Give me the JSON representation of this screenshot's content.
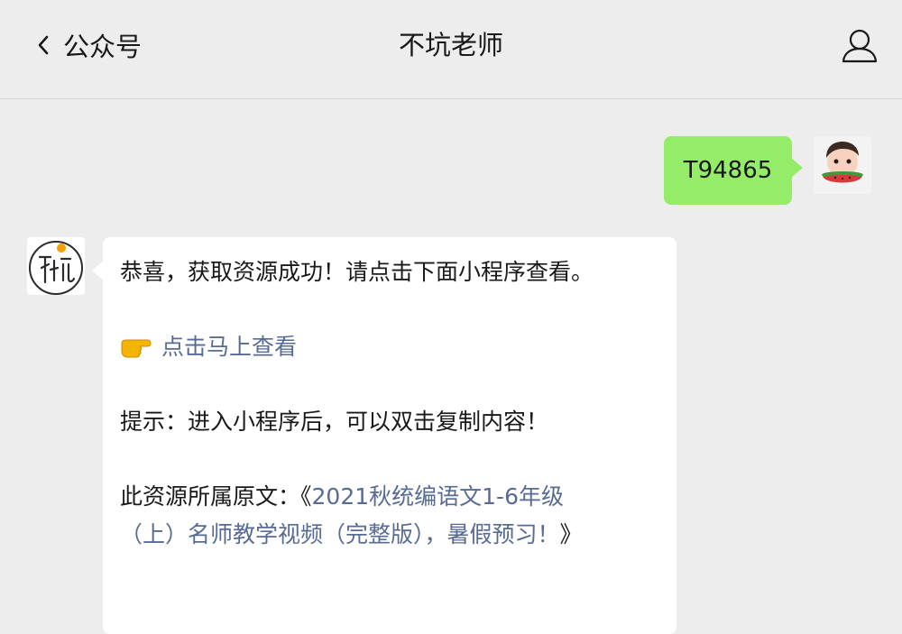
{
  "header": {
    "back_label": "公众号",
    "title": "不坑老师",
    "icons": {
      "back": "chevron-left-icon",
      "profile": "person-icon"
    }
  },
  "messages": {
    "outgoing": {
      "text": "T94865"
    },
    "incoming": {
      "line1": "恭喜，获取资源成功！请点击下面小程序查看。",
      "link_text": "点击马上查看",
      "pointer_icon": "pointing-hand-icon",
      "tip": "提示：进入小程序后，可以双击复制内容！",
      "source_prefix": "此资源所属原文：《",
      "source_link_line1": "2021秋统编语文1-6年级",
      "source_link_line2": "（上）名师教学视频（完整版），暑假预习！",
      "source_suffix": "》"
    }
  },
  "colors": {
    "background": "#ededed",
    "outgoing_bubble": "#95ec69",
    "incoming_bubble": "#ffffff",
    "link": "#576b95"
  }
}
